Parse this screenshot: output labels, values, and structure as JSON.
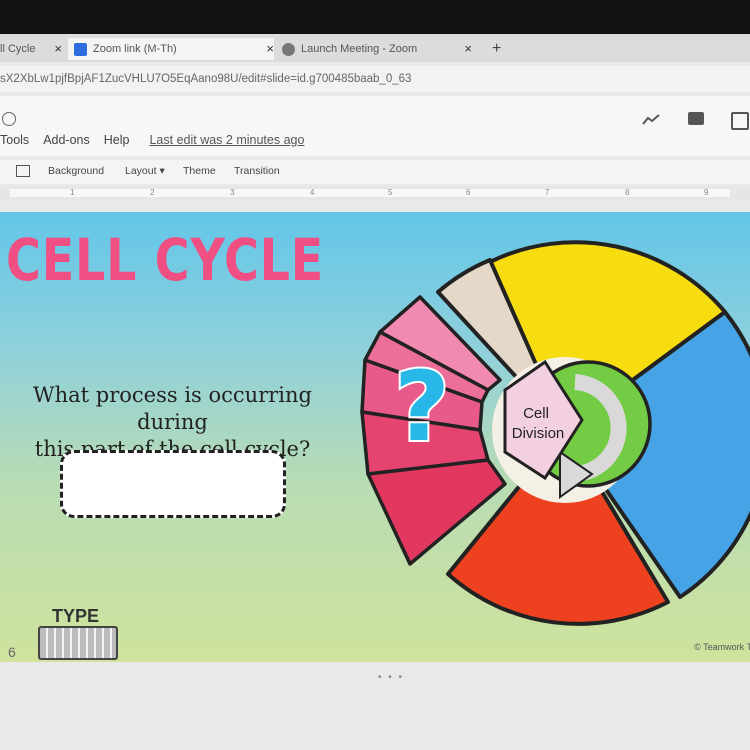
{
  "browser": {
    "tabs": [
      {
        "label": "ll Cycle",
        "close": "×"
      },
      {
        "label": "Zoom link (M-Th)",
        "close": "×"
      },
      {
        "label": "Launch Meeting - Zoom",
        "close": "×"
      }
    ],
    "new_tab": "+",
    "url": "sX2XbLw1pjfBpjAF1ZucVHLU7O5EqAano98U/edit#slide=id.g700485baab_0_63"
  },
  "app": {
    "menu": [
      "Tools",
      "Add-ons",
      "Help"
    ],
    "last_edit": "Last edit was 2 minutes ago",
    "toolbar": {
      "background": "Background",
      "layout": "Layout",
      "theme": "Theme",
      "transition": "Transition"
    },
    "ruler": [
      "1",
      "2",
      "3",
      "4",
      "5",
      "6",
      "7",
      "8",
      "9"
    ]
  },
  "slide": {
    "title": "CELL CYCLE",
    "question_line1": "What process is occurring during",
    "question_line2": "this part of the cell cycle?",
    "center_label_1": "Cell",
    "center_label_2": "Division",
    "question_mark": "?",
    "type_label": "TYPE",
    "slide_number": "6",
    "credit": "© Teamwork Te"
  },
  "colors": {
    "title_pink": "#ef4f82",
    "yellow": "#f7dd10",
    "blue": "#46a4e6",
    "red": "#ee4120",
    "beige": "#e5d8c8",
    "pink_light": "#f08ab0",
    "pink_dark": "#e64470",
    "green": "#74cc45"
  }
}
